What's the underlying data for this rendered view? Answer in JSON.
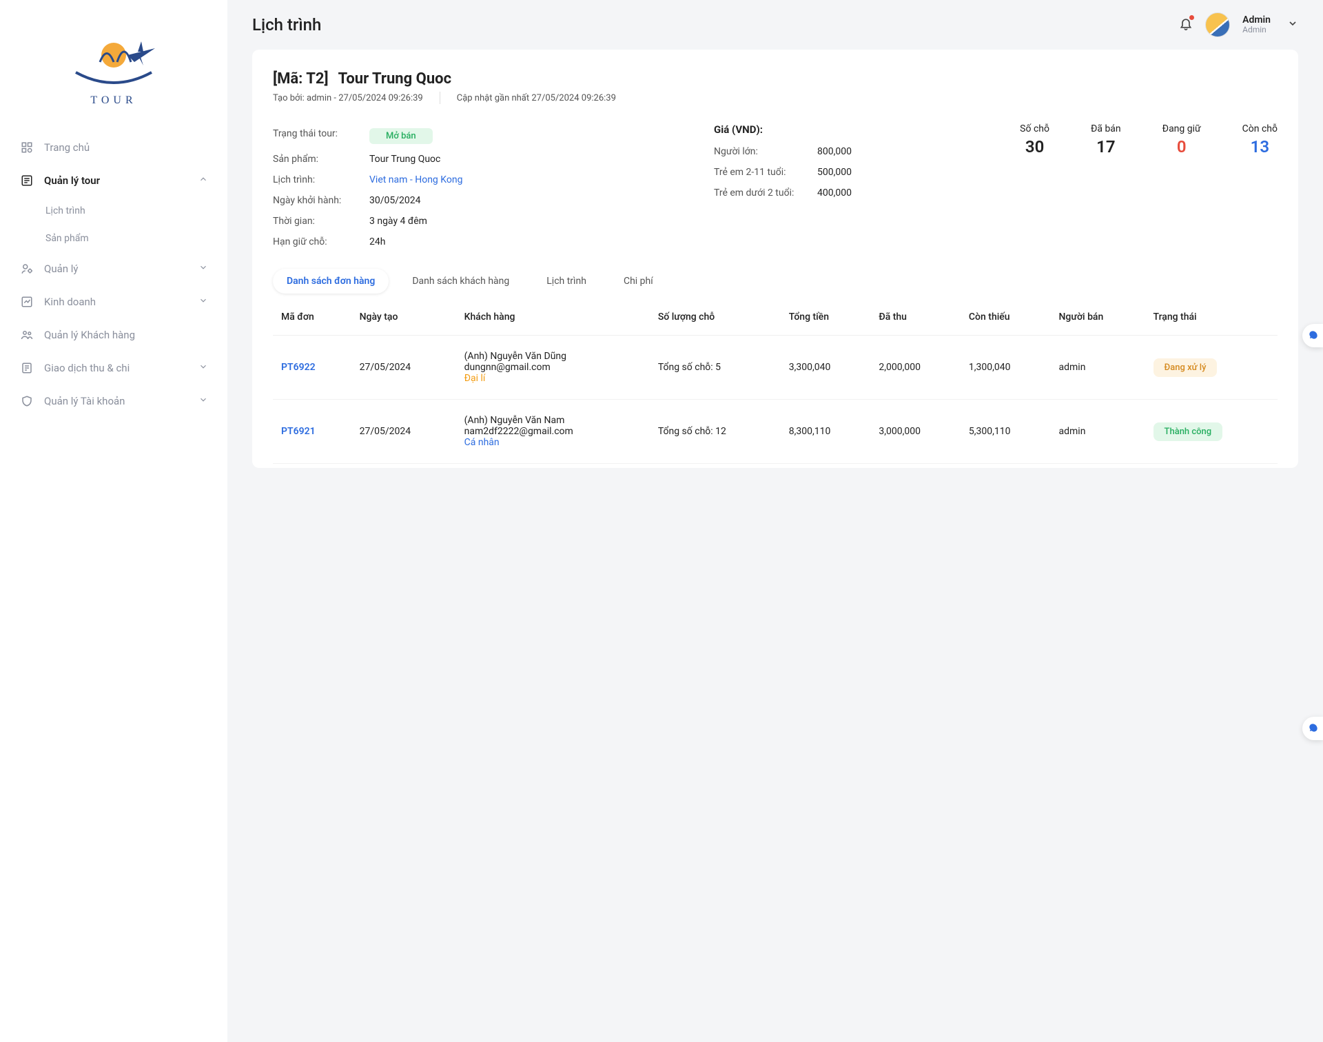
{
  "page_title": "Lịch trình",
  "user": {
    "name": "Admin",
    "role": "Admin"
  },
  "sidebar": {
    "home": "Trang chủ",
    "tour_mgmt": "Quản lý tour",
    "schedule": "Lịch trình",
    "product": "Sản phẩm",
    "management": "Quản lý",
    "business": "Kinh doanh",
    "customer_mgmt": "Quản lý Khách hàng",
    "transactions": "Giao dịch thu & chi",
    "account_mgmt": "Quản lý Tài khoản"
  },
  "detail": {
    "code_label": "[Mã: T2]",
    "name": "Tour Trung Quoc",
    "created_by_line": "Tạo bởi: admin - 27/05/2024 09:26:39",
    "updated_line": "Cập nhật gần nhất 27/05/2024 09:26:39",
    "labels": {
      "status": "Trạng thái tour:",
      "product": "Sản phẩm:",
      "itinerary": "Lịch trình:",
      "depart": "Ngày khởi hành:",
      "duration": "Thời gian:",
      "hold": "Hạn giữ chỗ:"
    },
    "values": {
      "status": "Mở bán",
      "product": "Tour Trung Quoc",
      "itinerary": "Viet nam - Hong Kong",
      "depart": "30/05/2024",
      "duration": "3 ngày 4 đêm",
      "hold": "24h"
    },
    "price_head": "Giá (VND):",
    "prices": {
      "adult_label": "Người lớn:",
      "adult": "800,000",
      "child_label": "Trẻ em 2-11 tuổi:",
      "child": "500,000",
      "baby_label": "Trẻ em dưới 2 tuổi:",
      "baby": "400,000"
    },
    "stats": {
      "seats_label": "Số chỗ",
      "seats": "30",
      "sold_label": "Đã bán",
      "sold": "17",
      "holding_label": "Đang giữ",
      "holding": "0",
      "remain_label": "Còn chỗ",
      "remain": "13"
    }
  },
  "tabs": {
    "orders": "Danh sách đơn hàng",
    "customers": "Danh sách khách hàng",
    "schedule": "Lịch trình",
    "cost": "Chi phí"
  },
  "table": {
    "headers": {
      "code": "Mã đơn",
      "created": "Ngày tạo",
      "customer": "Khách hàng",
      "seats": "Số lượng chỗ",
      "total": "Tổng tiền",
      "paid": "Đã thu",
      "remaining": "Còn thiếu",
      "seller": "Người bán",
      "status": "Trạng thái"
    },
    "rows": [
      {
        "code": "PT6922",
        "created": "27/05/2024",
        "cust_name": "(Anh) Nguyễn Văn Dũng",
        "cust_email": "dungnn@gmail.com",
        "cust_type": "Đại lí",
        "cust_type_class": "agent",
        "seats": "Tổng số chỗ: 5",
        "total": "3,300,040",
        "paid": "2,000,000",
        "remaining": "1,300,040",
        "seller": "admin",
        "status": "Đang xử lý",
        "status_class": "processing"
      },
      {
        "code": "PT6921",
        "created": "27/05/2024",
        "cust_name": "(Anh) Nguyễn Văn Nam",
        "cust_email": "nam2df2222@gmail.com",
        "cust_type": "Cá nhân",
        "cust_type_class": "personal",
        "seats": "Tổng số chỗ: 12",
        "total": "8,300,110",
        "paid": "3,000,000",
        "remaining": "5,300,110",
        "seller": "admin",
        "status": "Thành công",
        "status_class": "success"
      }
    ]
  },
  "logo_text": "TOUR"
}
